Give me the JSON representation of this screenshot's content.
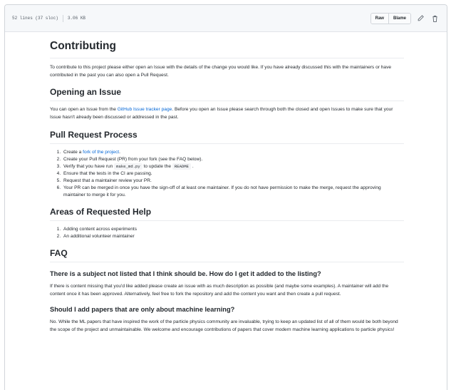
{
  "file_header": {
    "lines": "52 lines (37 sloc)",
    "size": "3.06 KB",
    "raw_label": "Raw",
    "blame_label": "Blame"
  },
  "doc": {
    "title": "Contributing",
    "intro": "To contribute to this project please either open an Issue with the details of the change you would like. If you have already discussed this with the maintainers or have contributed in the past you can also open a Pull Request.",
    "opening_issue": {
      "heading": "Opening an Issue",
      "text_before": "You can open an Issue from the ",
      "link": "GitHub Issue tracker page",
      "text_after": ". Before you open an Issue please search through both the closed and open Issues to make sure that your Issue hasn't already been discussed or addressed in the past."
    },
    "pr_process": {
      "heading": "Pull Request Process",
      "item1_before": "Create a ",
      "item1_link": "fork of the project",
      "item1_after": ".",
      "item2": "Create your Pull Request (PR) from your fork (see the FAQ below).",
      "item3_before": "Verify that you have run ",
      "item3_code1": "make_md.py",
      "item3_mid": " to update the ",
      "item3_code2": "README",
      "item3_after": " .",
      "item4": "Ensure that the tests in the CI are passing.",
      "item5": "Request that a maintainer review your PR.",
      "item6": "Your PR can be merged in once you have the sign-off of at least one maintainer. If you do not have permission to make the merge, request the approving maintainer to merge it for you."
    },
    "help": {
      "heading": "Areas of Requested Help",
      "item1": "Adding content across experiments",
      "item2": "An additional volunteer maintainer"
    },
    "faq": {
      "heading": "FAQ",
      "q1": "There is a subject not listed that I think should be. How do I get it added to the listing?",
      "a1": "If there is content missing that you'd like added please create an issue with as much description as possible (and maybe some examples). A maintainer will add the content once it has been approved. Alternatively, feel free to fork the repository and add the content you want and then create a pull request.",
      "q2": "Should I add papers that are only about machine learning?",
      "a2": "No. While the ML papers that have inspired the work of the particle physics community are invaluable, trying to keep an updated list of all of them would be both beyond the scope of the project and unmaintainable. We welcome and encourage contributions of papers that cover modern machine learning applications to particle physics!"
    }
  }
}
